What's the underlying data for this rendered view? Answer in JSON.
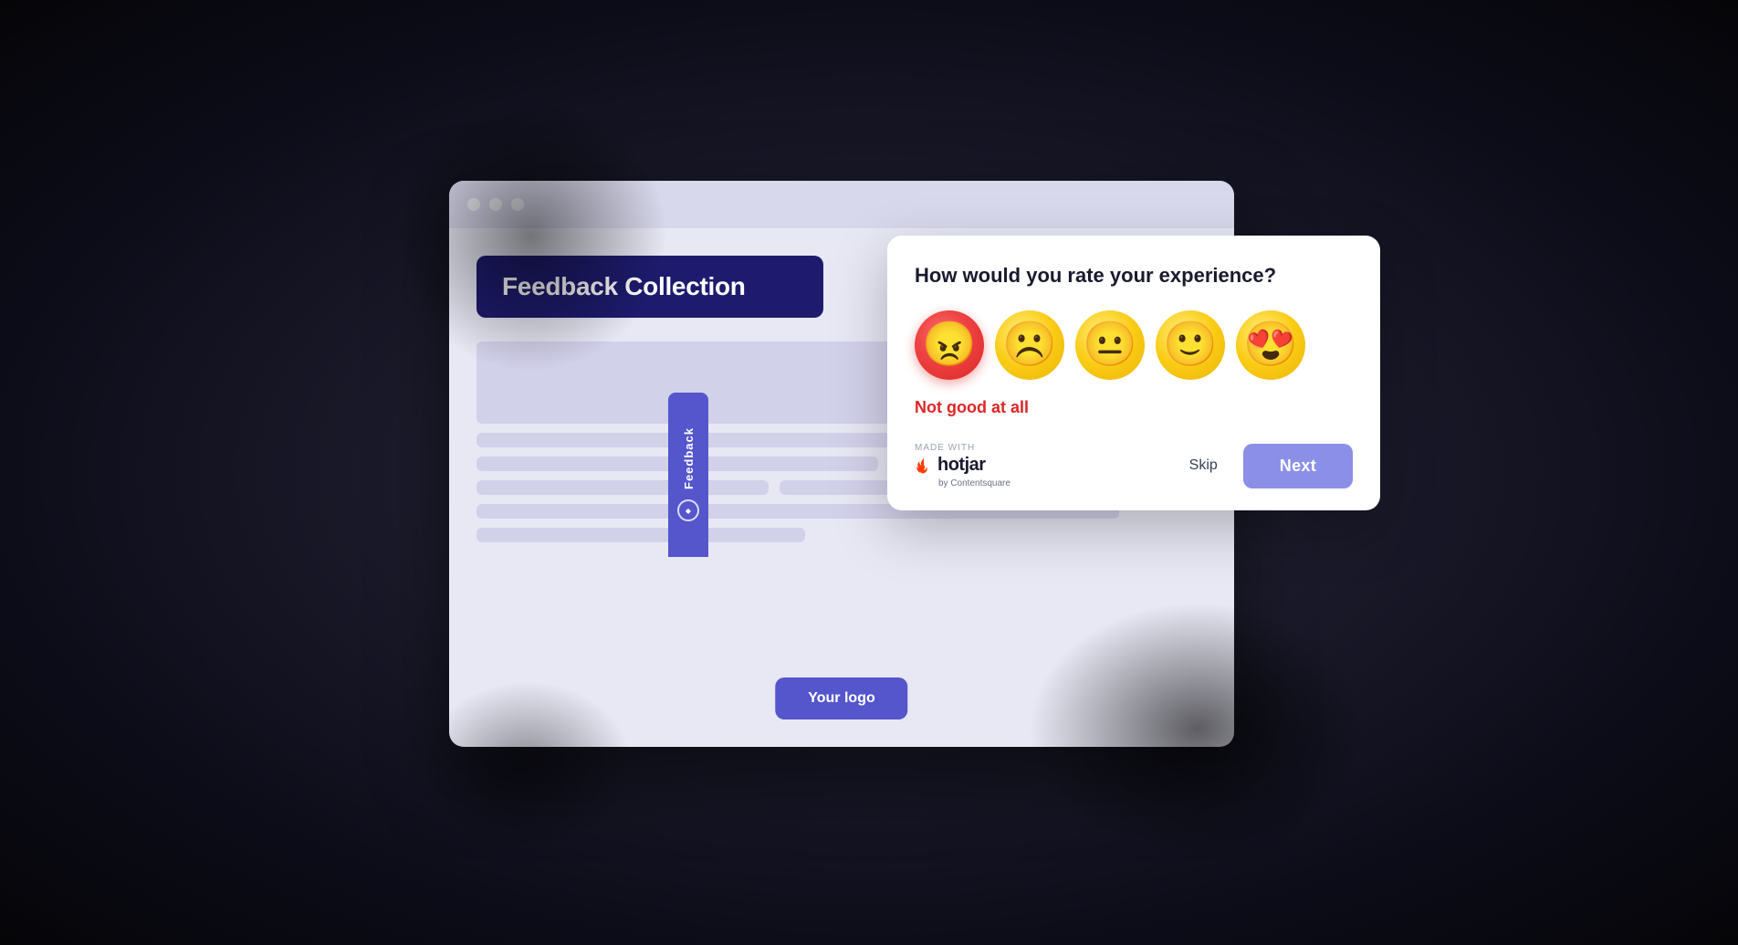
{
  "browser": {
    "dots": [
      "dot1",
      "dot2",
      "dot3"
    ]
  },
  "feedback_header": {
    "label": "Feedback Collection"
  },
  "feedback_tab": {
    "text": "Feedback"
  },
  "your_logo": {
    "label": "Your logo"
  },
  "survey": {
    "question": "How would you rate your experience?",
    "emojis": [
      {
        "id": "angry",
        "symbol": "😠",
        "label": "angry"
      },
      {
        "id": "sad",
        "symbol": "☹️",
        "label": "sad"
      },
      {
        "id": "neutral",
        "symbol": "😐",
        "label": "neutral"
      },
      {
        "id": "happy",
        "symbol": "🙂",
        "label": "happy"
      },
      {
        "id": "love",
        "symbol": "😍",
        "label": "love"
      }
    ],
    "selected_label": "Not good at all",
    "made_with_prefix": "MADE WITH",
    "hotjar_name": "hotjar",
    "contentsquare_label": "by Contentsquare",
    "skip_label": "Skip",
    "next_label": "Next"
  }
}
